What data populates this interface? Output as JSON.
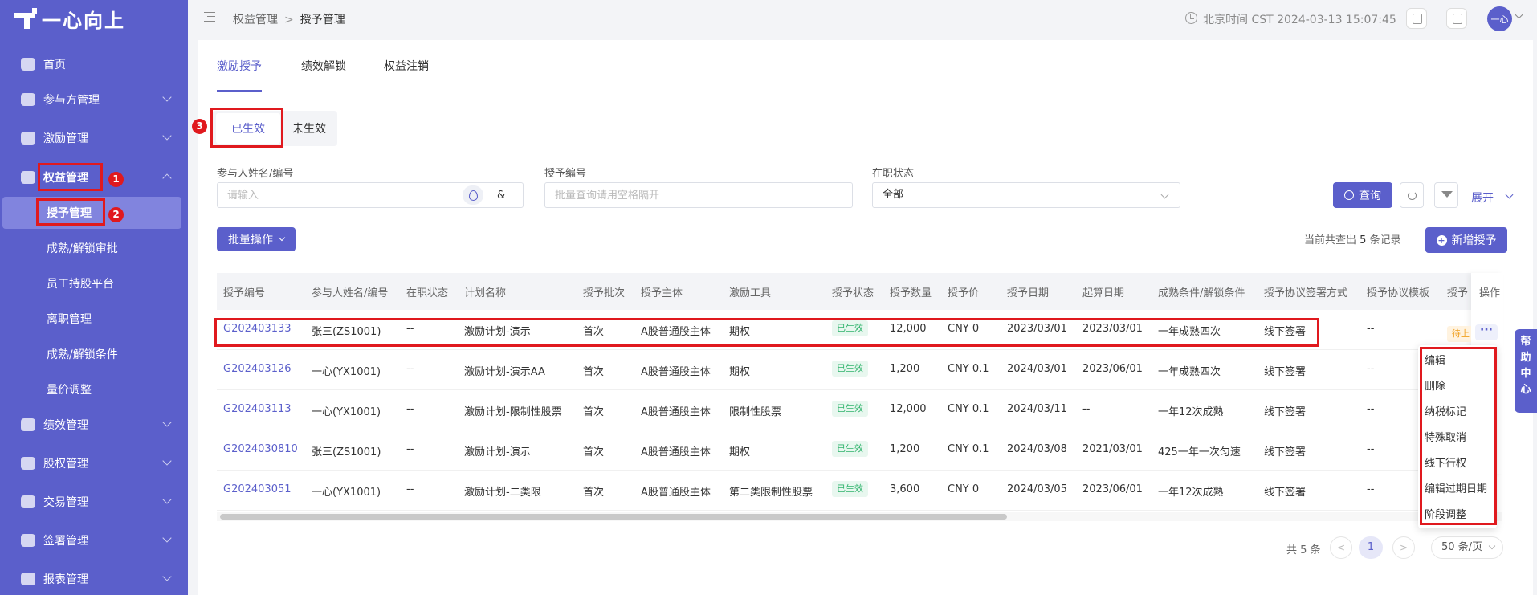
{
  "app": {
    "logo_text": "一心向上"
  },
  "sidebar": {
    "items": [
      {
        "label": "首页",
        "icon": "home-icon"
      },
      {
        "label": "参与方管理",
        "icon": "users-icon"
      },
      {
        "label": "激励管理",
        "icon": "incentive-icon"
      },
      {
        "label": "权益管理",
        "icon": "equity-icon"
      },
      {
        "label": "绩效管理",
        "icon": "performance-icon"
      },
      {
        "label": "股权管理",
        "icon": "shares-icon"
      },
      {
        "label": "交易管理",
        "icon": "trade-icon"
      },
      {
        "label": "签署管理",
        "icon": "sign-icon"
      },
      {
        "label": "报表管理",
        "icon": "report-icon"
      }
    ],
    "sub_items": [
      "授予管理",
      "成熟/解锁审批",
      "员工持股平台",
      "离职管理",
      "成熟/解锁条件",
      "量价调整"
    ]
  },
  "header": {
    "breadcrumb": [
      "权益管理",
      "授予管理"
    ],
    "time": "北京时间 CST 2024-03-13 15:07:45",
    "avatar_text": "一心"
  },
  "tabs": [
    "激励授予",
    "绩效解锁",
    "权益注销"
  ],
  "status_tabs": [
    "已生效",
    "未生效"
  ],
  "filters": {
    "name_label": "参与人姓名/编号",
    "name_placeholder": "请输入",
    "link_symbol": "&",
    "grant_no_label": "授予编号",
    "grant_no_placeholder": "批量查询请用空格隔开",
    "employment_label": "在职状态",
    "employment_value": "全部",
    "search_button": "查询",
    "expand_link": "展开"
  },
  "toolbar": {
    "batch_button": "批量操作",
    "record_prefix": "当前共查出",
    "record_count": "5",
    "record_suffix": "条记录",
    "add_button": "新增授予"
  },
  "table": {
    "columns": [
      "授予编号",
      "参与人姓名/编号",
      "在职状态",
      "计划名称",
      "授予批次",
      "授予主体",
      "激励工具",
      "授予状态",
      "授予数量",
      "授予价",
      "授予日期",
      "起算日期",
      "成熟条件/解锁条件",
      "授予协议签署方式",
      "授予协议模板",
      "授予",
      "操作"
    ],
    "rows": [
      [
        "G202403133",
        "张三(ZS1001)",
        "--",
        "激励计划-演示",
        "首次",
        "A股普通股主体",
        "期权",
        "已生效",
        "12,000",
        "CNY  0",
        "2023/03/01",
        "2023/03/01",
        "一年成熟四次",
        "线下签署",
        "--"
      ],
      [
        "G202403126",
        "一心(YX1001)",
        "--",
        "激励计划-演示AA",
        "首次",
        "A股普通股主体",
        "期权",
        "已生效",
        "1,200",
        "CNY  0.1",
        "2024/03/01",
        "2023/06/01",
        "一年成熟四次",
        "线下签署",
        "--"
      ],
      [
        "G202403113",
        "一心(YX1001)",
        "--",
        "激励计划-限制性股票",
        "首次",
        "A股普通股主体",
        "限制性股票",
        "已生效",
        "12,000",
        "CNY  0.1",
        "2024/03/11",
        "--",
        "一年12次成熟",
        "线下签署",
        "--"
      ],
      [
        "G2024030810",
        "张三(ZS1001)",
        "--",
        "激励计划-演示",
        "首次",
        "A股普通股主体",
        "期权",
        "已生效",
        "1,200",
        "CNY  0.1",
        "2024/03/08",
        "2021/03/01",
        "425一年一次匀速",
        "线下签署",
        "--"
      ],
      [
        "G202403051",
        "一心(YX1001)",
        "--",
        "激励计划-二类限",
        "首次",
        "A股普通股主体",
        "第二类限制性股票",
        "已生效",
        "3,600",
        "CNY  0",
        "2024/03/05",
        "2023/06/01",
        "一年12次成熟",
        "线下签署",
        "--"
      ]
    ],
    "first_row_extra_status": "待上",
    "more_label": "···"
  },
  "dropdown": [
    "编辑",
    "删除",
    "纳税标记",
    "特殊取消",
    "线下行权",
    "编辑过期日期",
    "阶段调整"
  ],
  "pagination": {
    "total": "共 5 条",
    "prev": "<",
    "current": "1",
    "next": ">",
    "page_size": "50 条/页"
  },
  "help": {
    "label": "帮助中心"
  },
  "annotations": [
    "1",
    "2",
    "3"
  ],
  "colors": {
    "primary": "#5b5fcb",
    "annotation": "#e0191e",
    "success": "#2fb36c"
  }
}
